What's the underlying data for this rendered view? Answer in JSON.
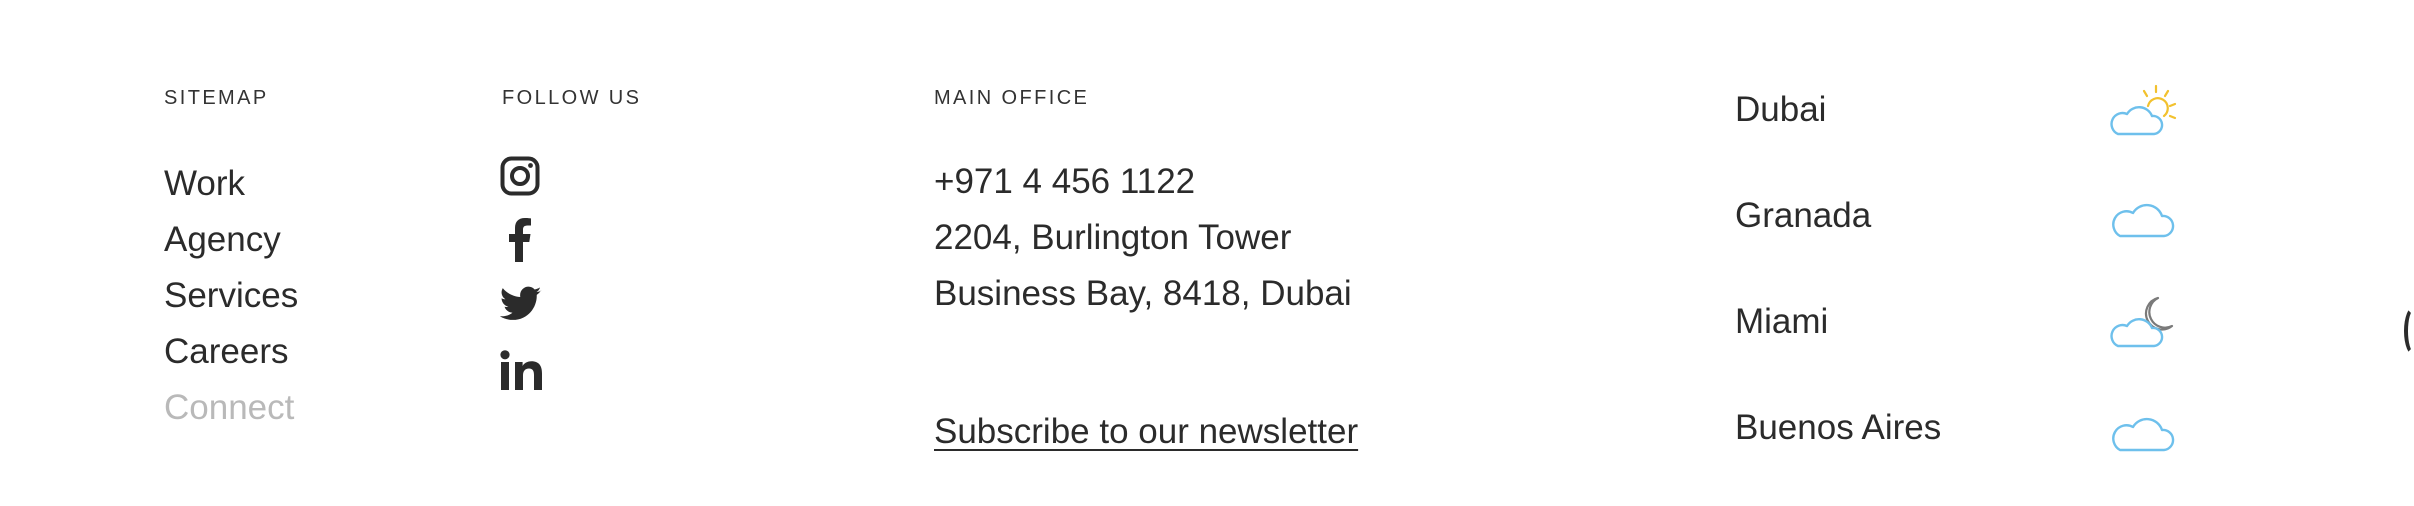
{
  "sitemap": {
    "heading": "SITEMAP",
    "items": [
      {
        "label": "Work"
      },
      {
        "label": "Agency"
      },
      {
        "label": "Services"
      },
      {
        "label": "Careers"
      },
      {
        "label": "Connect"
      }
    ]
  },
  "follow": {
    "heading": "FOLLOW US",
    "icons": [
      "instagram-icon",
      "facebook-icon",
      "twitter-icon",
      "linkedin-icon"
    ]
  },
  "office": {
    "heading": "MAIN OFFICE",
    "phone": "+971 4 456 1122",
    "address_line1": "2204, Burlington Tower",
    "address_line2": "Business Bay, 8418, Dubai",
    "newsletter_link": "Subscribe to our newsletter"
  },
  "weather": {
    "cities": [
      {
        "name": "Dubai",
        "icon": "partly-sunny-icon"
      },
      {
        "name": "Granada",
        "icon": "cloud-icon"
      },
      {
        "name": "Miami",
        "icon": "partly-cloudy-night-icon"
      },
      {
        "name": "Buenos Aires",
        "icon": "cloud-icon"
      }
    ]
  },
  "colors": {
    "text": "#2b2b2b",
    "muted": "#b9b9b9",
    "cloud": "#6ec0ec",
    "sun": "#f2c12e",
    "moon": "#7a7a7a"
  }
}
